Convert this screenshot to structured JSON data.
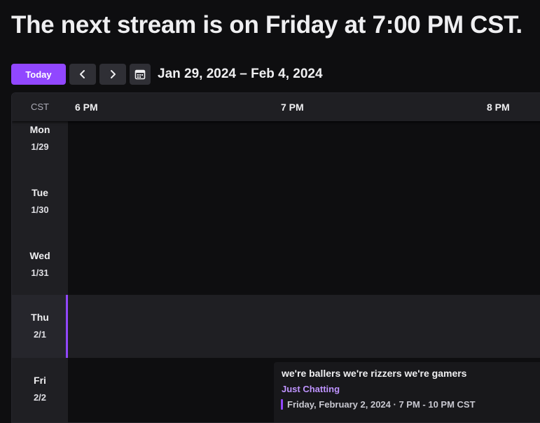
{
  "headline": "The next stream is on Friday at 7:00 PM CST.",
  "toolbar": {
    "today_label": "Today",
    "prev_icon": "chevron-left-icon",
    "next_icon": "chevron-right-icon",
    "calendar_icon": "calendar-icon",
    "date_range": "Jan 29, 2024 – Feb 4, 2024"
  },
  "calendar": {
    "timezone": "CST",
    "hours": [
      "6 PM",
      "7 PM",
      "8 PM"
    ],
    "days": [
      {
        "name": "Mon",
        "date": "1/29"
      },
      {
        "name": "Tue",
        "date": "1/30"
      },
      {
        "name": "Wed",
        "date": "1/31"
      },
      {
        "name": "Thu",
        "date": "2/1"
      },
      {
        "name": "Fri",
        "date": "2/2"
      }
    ],
    "today_day": "Thu",
    "event": {
      "title": "we're ballers we're rizzers we're gamers",
      "category": "Just Chatting",
      "time": "Friday, February 2, 2024 · 7 PM - 10 PM CST"
    }
  },
  "colors": {
    "accent": "#9147ff",
    "category": "#bf94ff",
    "background": "#0e0e10",
    "panel": "#1f1f23"
  }
}
